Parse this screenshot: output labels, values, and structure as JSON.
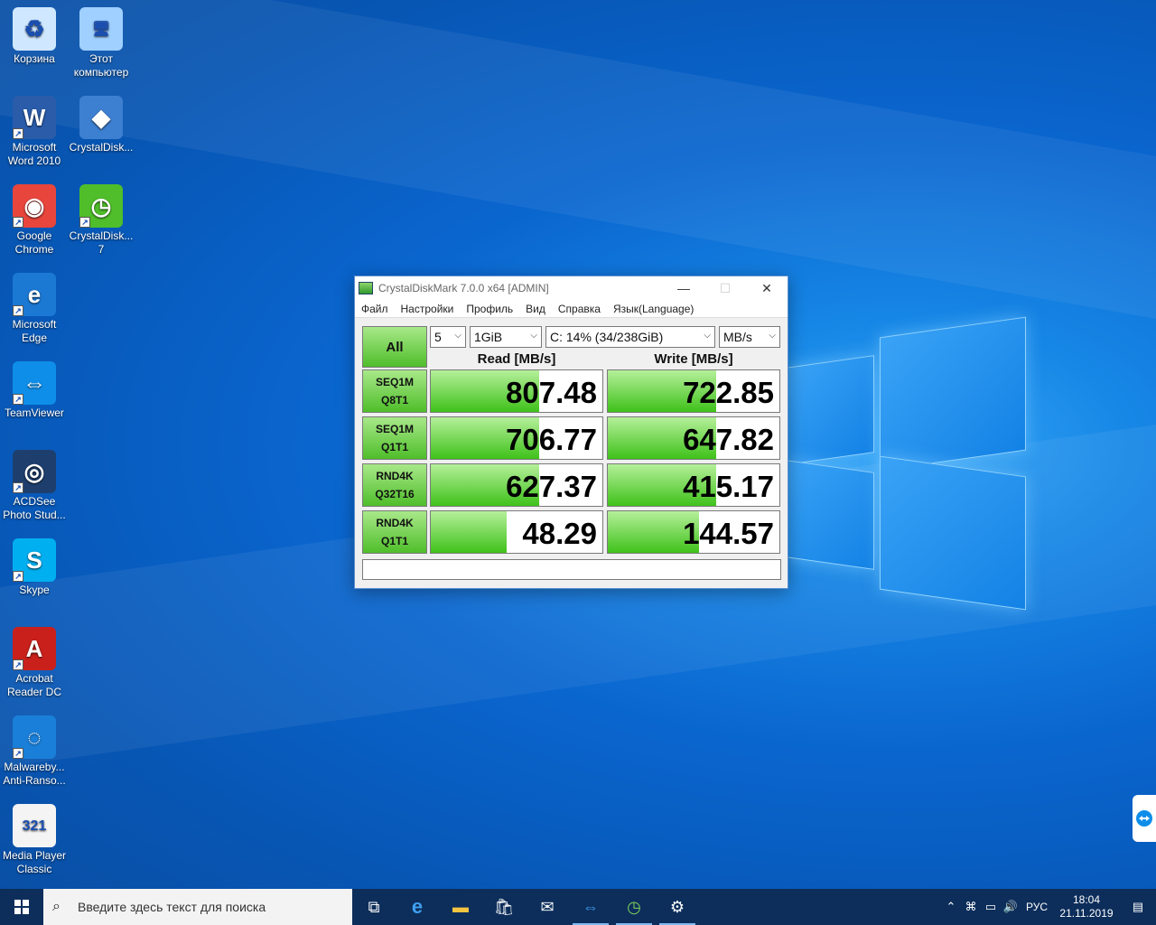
{
  "desktop": {
    "icons": [
      {
        "name": "recycle-bin",
        "label_lines": [
          "Корзина"
        ],
        "glyph": "♻",
        "color": "#cfe8ff"
      },
      {
        "name": "this-pc",
        "label_lines": [
          "Этот",
          "компьютер"
        ],
        "glyph": "🖥",
        "color": "#9fd0ff"
      },
      {
        "name": "word-2010",
        "label_lines": [
          "Microsoft",
          "Word 2010"
        ],
        "glyph": "W",
        "color": "#2a5caa"
      },
      {
        "name": "crystaldiskinfo",
        "label_lines": [
          "CrystalDisk..."
        ],
        "glyph": "◆",
        "color": "#3d7fd0"
      },
      {
        "name": "google-chrome",
        "label_lines": [
          "Google",
          "Chrome"
        ],
        "glyph": "◉",
        "color": "#e8453c"
      },
      {
        "name": "crystaldiskmark",
        "label_lines": [
          "CrystalDisk...",
          "7"
        ],
        "glyph": "◷",
        "color": "#4fbe2a"
      },
      {
        "name": "microsoft-edge",
        "label_lines": [
          "Microsoft",
          "Edge"
        ],
        "glyph": "e",
        "color": "#1b79d4"
      },
      {
        "name": "teamviewer",
        "label_lines": [
          "TeamViewer"
        ],
        "glyph": "⇔",
        "color": "#0e8ee9"
      },
      {
        "name": "acdsee",
        "label_lines": [
          "ACDSee",
          "Photo Stud..."
        ],
        "glyph": "◎",
        "color": "#1e3f6e"
      },
      {
        "name": "skype",
        "label_lines": [
          "Skype"
        ],
        "glyph": "S",
        "color": "#00aff0"
      },
      {
        "name": "acrobat-reader",
        "label_lines": [
          "Acrobat",
          "Reader DC"
        ],
        "glyph": "A",
        "color": "#c9201b"
      },
      {
        "name": "malwarebytes",
        "label_lines": [
          "Malwareby...",
          "Anti-Ranso..."
        ],
        "glyph": "◌",
        "color": "#1a7fd8"
      },
      {
        "name": "media-player-classic",
        "label_lines": [
          "Media Player",
          "Classic"
        ],
        "glyph": "321",
        "color": "#f4f4f4"
      }
    ]
  },
  "window": {
    "title": "CrystalDiskMark 7.0.0 x64 [ADMIN]",
    "minimize": "—",
    "maximize": "☐",
    "close": "✕",
    "menu": [
      "Файл",
      "Настройки",
      "Профиль",
      "Вид",
      "Справка",
      "Язык(Language)"
    ],
    "all_label": "All",
    "count_value": "5",
    "size_value": "1GiB",
    "drive_value": "C: 14% (34/238GiB)",
    "unit_value": "MB/s",
    "read_header": "Read [MB/s]",
    "write_header": "Write [MB/s]",
    "tests": [
      {
        "line1": "SEQ1M",
        "line2": "Q8T1",
        "read": "807.48",
        "read_frac": 0.63,
        "write": "722.85",
        "write_frac": 0.63
      },
      {
        "line1": "SEQ1M",
        "line2": "Q1T1",
        "read": "706.77",
        "read_frac": 0.63,
        "write": "647.82",
        "write_frac": 0.63
      },
      {
        "line1": "RND4K",
        "line2": "Q32T16",
        "read": "627.37",
        "read_frac": 0.63,
        "write": "415.17",
        "write_frac": 0.63
      },
      {
        "line1": "RND4K",
        "line2": "Q1T1",
        "read": "48.29",
        "read_frac": 0.44,
        "write": "144.57",
        "write_frac": 0.53
      }
    ],
    "status_text": ""
  },
  "taskbar": {
    "search_placeholder": "Введите здесь текст для поиска",
    "language": "РУС",
    "time": "18:04",
    "date": "21.11.2019"
  }
}
